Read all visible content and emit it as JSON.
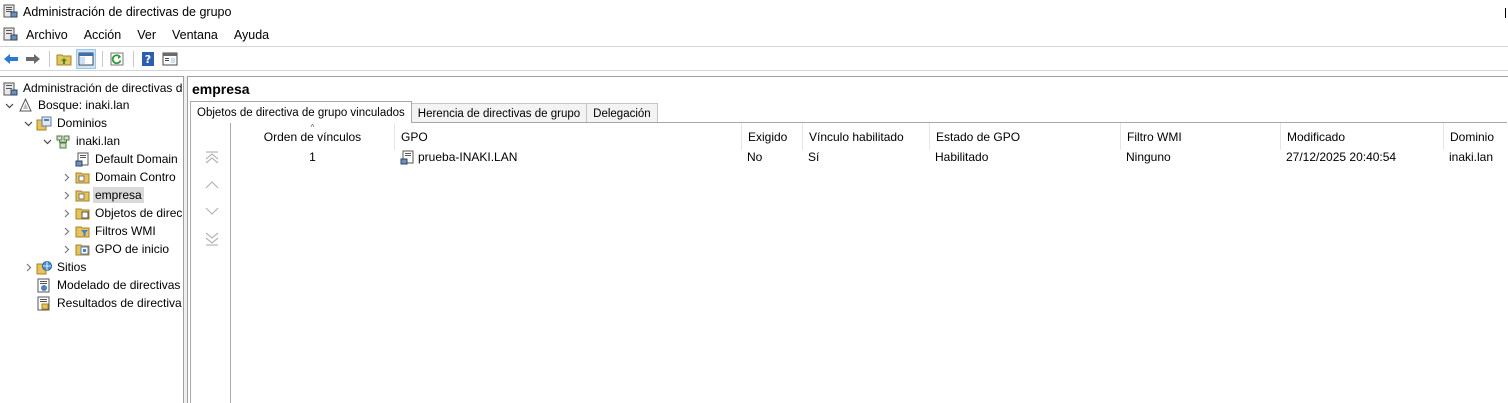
{
  "window": {
    "title": "Administración de directivas de grupo"
  },
  "menu": [
    "Archivo",
    "Acción",
    "Ver",
    "Ventana",
    "Ayuda"
  ],
  "toolbar": {
    "buttons": [
      "back-icon",
      "forward-icon",
      "up-folder-icon",
      "show-hide-tree-icon",
      "refresh-icon",
      "help-icon",
      "properties-icon"
    ]
  },
  "tree": {
    "root": "Administración de directivas d",
    "forest": "Bosque: inaki.lan",
    "domains": "Dominios",
    "domain": "inaki.lan",
    "default_domain": "Default Domain",
    "domain_controllers": "Domain Contro",
    "empresa": "empresa",
    "gpo_objects": "Objetos de direc",
    "wmi_filters": "Filtros WMI",
    "starter_gpos": "GPO de inicio",
    "sites": "Sitios",
    "modeling": "Modelado de directivas",
    "results": "Resultados de directiva"
  },
  "main": {
    "title": "empresa",
    "tabs": [
      {
        "label": "Objetos de directiva de grupo vinculados",
        "active": true
      },
      {
        "label": "Herencia de directivas de grupo",
        "active": false
      },
      {
        "label": "Delegación",
        "active": false
      }
    ],
    "columns": [
      "Orden de vínculos",
      "GPO",
      "Exigido",
      "Vínculo habilitado",
      "Estado de GPO",
      "Filtro WMI",
      "Modificado",
      "Dominio"
    ],
    "rows": [
      {
        "order": "1",
        "gpo": "prueba-INAKI.LAN",
        "enforced": "No",
        "link_enabled": "Sí",
        "gpo_status": "Habilitado",
        "wmi_filter": "Ninguno",
        "modified": "27/12/2025 20:40:54",
        "domain": "inaki.lan"
      }
    ]
  },
  "colors": {
    "selection": "#d9d9d9",
    "toolbar_pressed": "#cce4f7",
    "border": "#a0a0a0"
  }
}
